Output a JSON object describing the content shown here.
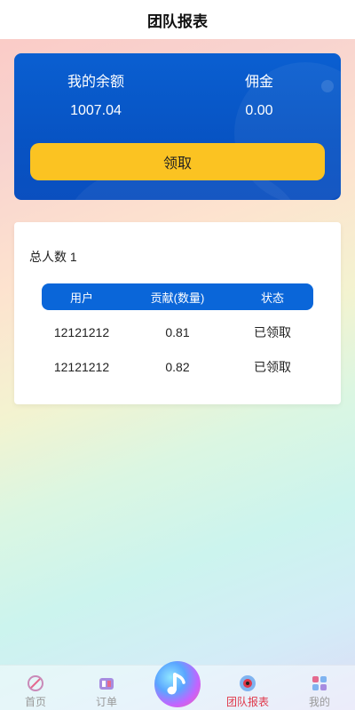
{
  "header": {
    "title": "团队报表"
  },
  "balance": {
    "my_balance_label": "我的余额",
    "my_balance_value": "1007.04",
    "commission_label": "佣金",
    "commission_value": "0.00",
    "claim_button": "领取"
  },
  "team": {
    "total_label": "总人数 1",
    "columns": [
      "用户",
      "贡献(数量)",
      "状态"
    ],
    "rows": [
      {
        "user": "12121212",
        "contribution": "0.81",
        "status": "已领取"
      },
      {
        "user": "12121212",
        "contribution": "0.82",
        "status": "已领取"
      }
    ]
  },
  "tabbar": {
    "items": [
      {
        "label": "首页",
        "icon": "home-icon"
      },
      {
        "label": "订单",
        "icon": "orders-icon"
      },
      {
        "label": "",
        "icon": "music-note-icon"
      },
      {
        "label": "团队报表",
        "icon": "team-report-icon",
        "active": true
      },
      {
        "label": "我的",
        "icon": "profile-icon"
      }
    ]
  },
  "colors": {
    "card_blue": "#0753c3",
    "claim_yellow": "#fbc322",
    "table_header_blue": "#0a66d9",
    "active_tab": "#e0384a"
  }
}
